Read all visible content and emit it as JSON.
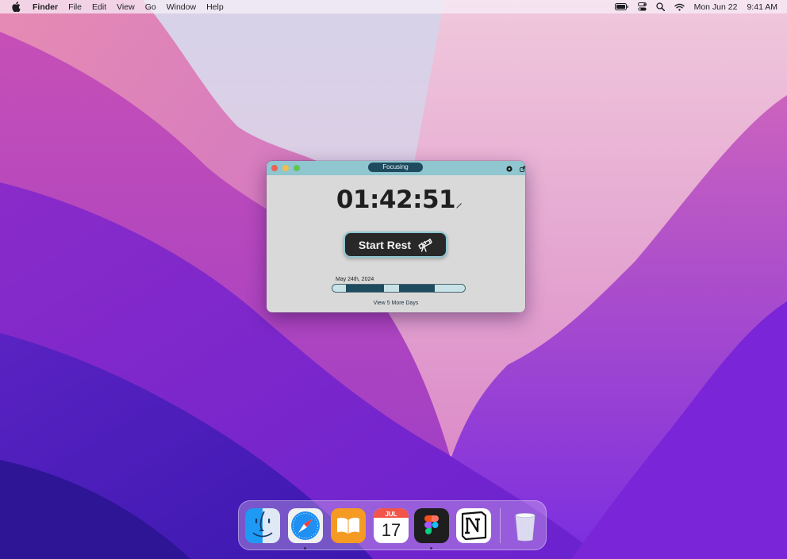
{
  "menubar": {
    "app_name": "Finder",
    "menus": [
      "File",
      "Edit",
      "View",
      "Go",
      "Window",
      "Help"
    ],
    "status_icons": [
      "battery-icon",
      "control-center-icon",
      "spotlight-search-icon",
      "wifi-icon"
    ],
    "date": "Mon Jun 22",
    "time": "9:41 AM"
  },
  "window": {
    "status": "Focusing",
    "timer": "01:42:51",
    "start_rest_label": "Start Rest",
    "session_date": "May 24th, 2024",
    "view_more_label": "View 5 More Days",
    "accent_color": "#8fc6cf",
    "dark_color": "#1f4b5f"
  },
  "dock": {
    "apps": [
      "Finder",
      "Safari",
      "Books",
      "Calendar",
      "Figma",
      "Notion",
      "Trash"
    ],
    "calendar_month": "JUL",
    "calendar_day": "17"
  }
}
